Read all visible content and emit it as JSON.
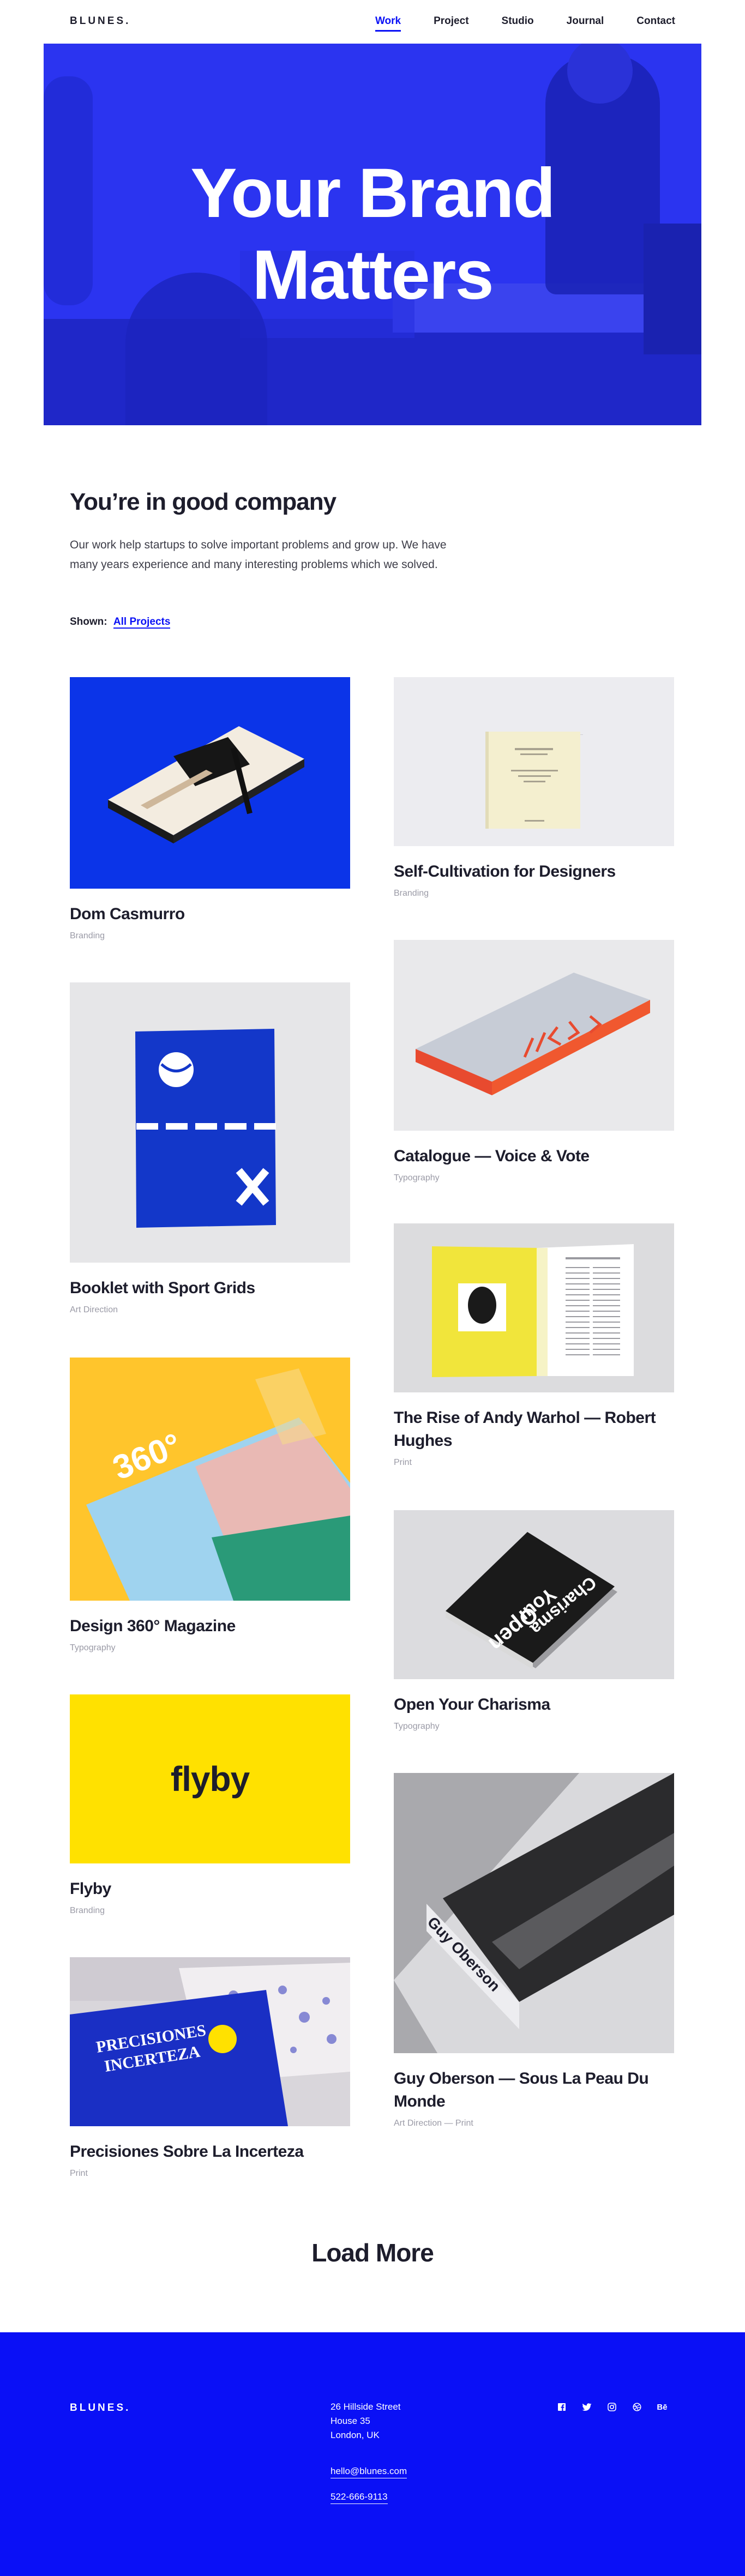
{
  "brand": "BLUNES.",
  "nav": [
    {
      "label": "Work"
    },
    {
      "label": "Project"
    },
    {
      "label": "Studio"
    },
    {
      "label": "Journal"
    },
    {
      "label": "Contact"
    }
  ],
  "hero": {
    "title_line1": "Your Brand",
    "title_line2": "Matters"
  },
  "intro": {
    "heading": "You’re in good company",
    "text": "Our work help startups to solve important problems and grow up. We have many years experience and many interesting problems which we solved.",
    "shown_label": "Shown:",
    "shown_link": "All Projects"
  },
  "projects": [
    {
      "title": "Dom Casmurro",
      "category": "Branding",
      "image": "book-on-blue"
    },
    {
      "title": "Self-Cultivation for Designers",
      "category": "Branding",
      "image": "cream-book"
    },
    {
      "title": "Booklet with Sport Grids",
      "category": "Art Direction",
      "image": "blue-booklet"
    },
    {
      "title": "Catalogue — Voice & Vote",
      "category": "Typography",
      "image": "grey-catalogue"
    },
    {
      "title": "The Rise of Andy Warhol — Robert Hughes",
      "category": "Print",
      "image": "open-magazine"
    },
    {
      "title": "Design 360° Magazine",
      "category": "Typography",
      "image": "magazine-on-yellow"
    },
    {
      "title": "Open Your Charisma",
      "category": "Typography",
      "image": "black-books"
    },
    {
      "title": "Flyby",
      "category": "Branding",
      "image": "flyby-logo",
      "logo_text": "flyby"
    },
    {
      "title": "Guy Oberson — Sous La Peau Du Monde",
      "category": "Art Direction — Print",
      "image": "guy-oberson-book"
    },
    {
      "title": "Precisiones Sobre La Incerteza",
      "category": "Print",
      "image": "precisiones-book"
    }
  ],
  "load_more": "Load More",
  "footer": {
    "brand": "BLUNES.",
    "address_line1": "26 Hillside Street",
    "address_line2": "House 35",
    "address_line3": "London, UK",
    "email": "hello@blunes.com",
    "phone": "522-666-9113",
    "social": [
      "facebook-icon",
      "twitter-icon",
      "instagram-icon",
      "dribbble-icon",
      "behance-icon"
    ]
  },
  "colors": {
    "accent": "#0a10f6",
    "hero": "#2b34f0",
    "text": "#1d1d2c"
  }
}
